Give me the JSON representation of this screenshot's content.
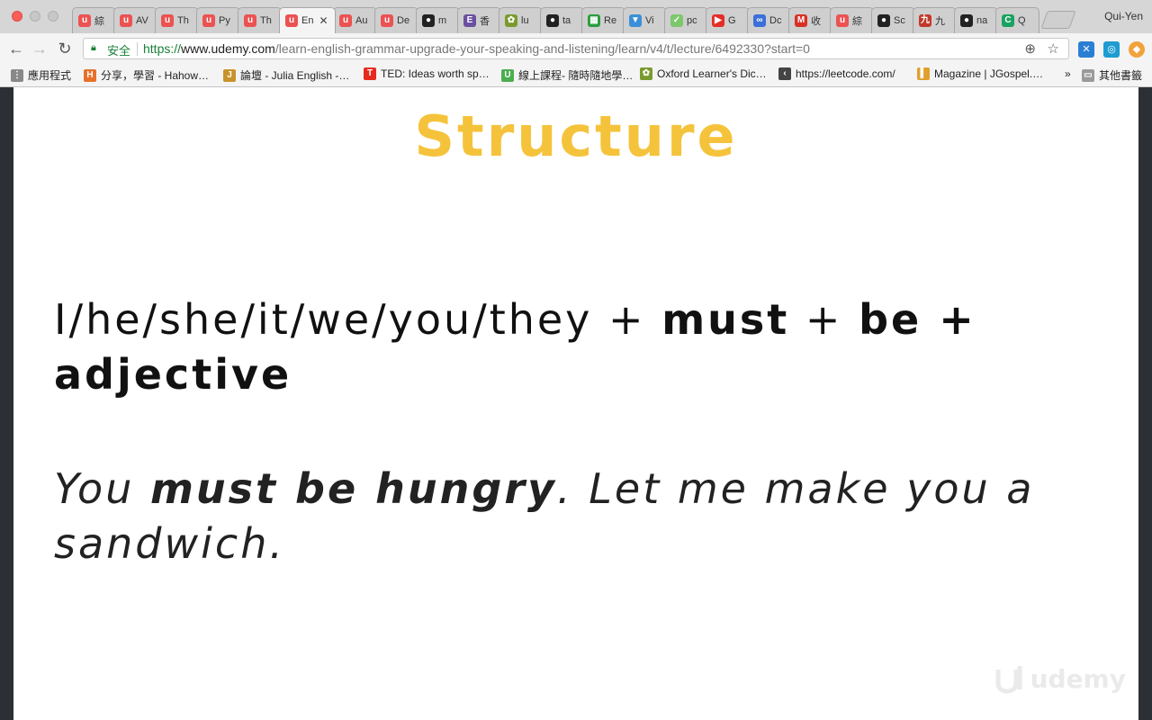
{
  "window": {
    "profile_name": "Qui-Yen"
  },
  "tabs": [
    {
      "label": "綜",
      "icon": "udemy-icon",
      "color": "#ec5252",
      "glyph": "u"
    },
    {
      "label": "AV",
      "icon": "udemy-icon",
      "color": "#ec5252",
      "glyph": "u"
    },
    {
      "label": "Th",
      "icon": "udemy-icon",
      "color": "#ec5252",
      "glyph": "u"
    },
    {
      "label": "Py",
      "icon": "udemy-icon",
      "color": "#ec5252",
      "glyph": "u"
    },
    {
      "label": "Th",
      "icon": "udemy-icon",
      "color": "#ec5252",
      "glyph": "u"
    },
    {
      "label": "En",
      "icon": "udemy-icon",
      "color": "#ec5252",
      "glyph": "u",
      "active": true
    },
    {
      "label": "Au",
      "icon": "udemy-icon",
      "color": "#ec5252",
      "glyph": "u"
    },
    {
      "label": "De",
      "icon": "udemy-icon",
      "color": "#ec5252",
      "glyph": "u"
    },
    {
      "label": "m",
      "icon": "github-icon",
      "color": "#222222",
      "glyph": "●"
    },
    {
      "label": "香",
      "icon": "e-icon",
      "color": "#6b4fa0",
      "glyph": "E"
    },
    {
      "label": "lu",
      "icon": "clover-icon",
      "color": "#7a9a2e",
      "glyph": "✿"
    },
    {
      "label": "ta",
      "icon": "github-icon",
      "color": "#222222",
      "glyph": "●"
    },
    {
      "label": "Re",
      "icon": "windows-icon",
      "color": "#2a9d3f",
      "glyph": "▦"
    },
    {
      "label": "Vi",
      "icon": "filter-icon",
      "color": "#3b8fd9",
      "glyph": "▼"
    },
    {
      "label": "pc",
      "icon": "check-icon",
      "color": "#7cc86b",
      "glyph": "✓"
    },
    {
      "label": "G",
      "icon": "youtube-icon",
      "color": "#e52d27",
      "glyph": "▶"
    },
    {
      "label": "Dc",
      "icon": "link-icon",
      "color": "#3b6fd9",
      "glyph": "∞"
    },
    {
      "label": "收",
      "icon": "gmail-icon",
      "color": "#d93025",
      "glyph": "M"
    },
    {
      "label": "綜",
      "icon": "udemy-icon",
      "color": "#ec5252",
      "glyph": "u"
    },
    {
      "label": "Sc",
      "icon": "github-icon",
      "color": "#222222",
      "glyph": "●"
    },
    {
      "label": "九",
      "icon": "nine-icon",
      "color": "#c0392b",
      "glyph": "九"
    },
    {
      "label": "na",
      "icon": "github-icon",
      "color": "#222222",
      "glyph": "●"
    },
    {
      "label": "Q",
      "icon": "c-icon",
      "color": "#1aa260",
      "glyph": "C"
    }
  ],
  "toolbar": {
    "secure_label": "安全",
    "url_scheme": "https://",
    "url_host": "www.udemy.com",
    "url_path": "/learn-english-grammar-upgrade-your-speaking-and-listening/learn/v4/t/lecture/6492330?start=0"
  },
  "bookmarks": [
    {
      "label": "應用程式",
      "icon": "apps-grid-icon",
      "color": "#888888",
      "glyph": "⋮"
    },
    {
      "label": "分享，學習 - Hahow…",
      "icon": "hahow-icon",
      "color": "#e8702a",
      "glyph": "H"
    },
    {
      "label": "論壇 - Julia English -…",
      "icon": "julia-icon",
      "color": "#c9932b",
      "glyph": "J"
    },
    {
      "label": "TED: Ideas worth sp…",
      "icon": "ted-icon",
      "color": "#e62b1e",
      "glyph": "T"
    },
    {
      "label": "線上課程- 隨時隨地學…",
      "icon": "u-icon",
      "color": "#4cae4f",
      "glyph": "U"
    },
    {
      "label": "Oxford Learner's Dic…",
      "icon": "clover-icon",
      "color": "#7a9a2e",
      "glyph": "✿"
    },
    {
      "label": "https://leetcode.com/",
      "icon": "leetcode-icon",
      "color": "#444444",
      "glyph": "‹"
    },
    {
      "label": "Magazine | JGospel.…",
      "icon": "magazine-icon",
      "color": "#e0a030",
      "glyph": "▌"
    }
  ],
  "bookmarks_overflow": "»",
  "other_bookmarks": "其他書籤",
  "slide": {
    "title": "Structure",
    "structure": {
      "subjects": "I/he/she/it/we/you/they",
      "plus1": " + ",
      "must": "must",
      "plus2": " + ",
      "be": "be",
      "plus3": " +",
      "adjective": "adjective"
    },
    "example": {
      "you": "You ",
      "phrase": "must be hungry",
      "rest": ". Let me make you a sandwich."
    },
    "watermark": "udemy"
  }
}
